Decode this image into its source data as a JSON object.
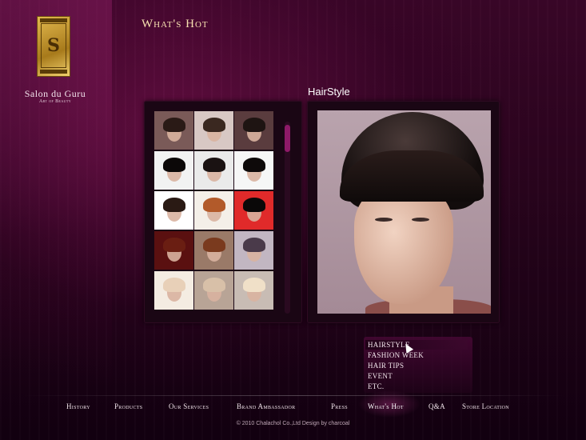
{
  "brand": {
    "name": "Salon du Guru",
    "tagline": "Art of Beauty",
    "logo_icon": "salon-crest-logo"
  },
  "page": {
    "title": "What's Hot"
  },
  "gallery": {
    "title": "HairStyle",
    "thumbnails": [
      {
        "hair": "#2a1a16",
        "bg": "#7a5a58"
      },
      {
        "hair": "#3a2820",
        "bg": "#d8c8c4"
      },
      {
        "hair": "#1e1412",
        "bg": "#5a3c3e"
      },
      {
        "hair": "#0c0808",
        "bg": "#f2f2f2"
      },
      {
        "hair": "#1a1212",
        "bg": "#eaeaea"
      },
      {
        "hair": "#0e0a0a",
        "bg": "#f6f6f6"
      },
      {
        "hair": "#2a1a14",
        "bg": "#ffffff"
      },
      {
        "hair": "#b25a2a",
        "bg": "#f4efe8"
      },
      {
        "hair": "#0a0808",
        "bg": "#e02a2a"
      },
      {
        "hair": "#6a1e12",
        "bg": "#5a1010"
      },
      {
        "hair": "#7a3a1e",
        "bg": "#9a7a68"
      },
      {
        "hair": "#4a3a4a",
        "bg": "#c2b6c2"
      },
      {
        "hair": "#e8d0b8",
        "bg": "#f4ece2"
      },
      {
        "hair": "#d8c0a8",
        "bg": "#b8a496"
      },
      {
        "hair": "#f0e0c8",
        "bg": "#c8bcb4"
      }
    ],
    "scroll_position": 0.02
  },
  "categories": [
    {
      "label": "Hairstyle",
      "active": true
    },
    {
      "label": "Fashion Week",
      "active": false
    },
    {
      "label": "Hair Tips",
      "active": false
    },
    {
      "label": "Event",
      "active": false
    },
    {
      "label": "Etc.",
      "active": false
    }
  ],
  "nav": [
    {
      "label": "History",
      "active": false
    },
    {
      "label": "Products",
      "active": false
    },
    {
      "label": "Our Services",
      "active": false
    },
    {
      "label": "Brand Ambassador",
      "active": false
    },
    {
      "label": "Press",
      "active": false
    },
    {
      "label": "What's Hot",
      "active": true
    },
    {
      "label": "Q&A",
      "active": false
    },
    {
      "label": "Store Location",
      "active": false
    }
  ],
  "footer": {
    "copyright": "© 2010 Chalachol Co.,Ltd Design by charcoal"
  },
  "colors": {
    "accent": "#8e1a68",
    "title": "#f7e1b0",
    "background": "#24031a"
  }
}
